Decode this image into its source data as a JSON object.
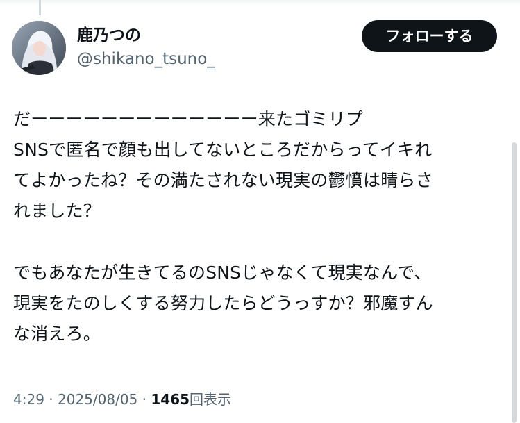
{
  "author": {
    "display_name": "鹿乃つの",
    "handle": "@shikano_tsuno_"
  },
  "follow_label": "フォローする",
  "tweet": {
    "lines": [
      "だーーーーーーーーーーーーー来たゴミリプ",
      "SNSで匿名で顔も出してないところだからってイキれ",
      "てよかったね？その満たされない現実の鬱憤は晴らさ",
      "れました？",
      "",
      "でもあなたが生きてるのSNSじゃなくて現実なんで、",
      "現実をたのしくする努力したらどうっすか？邪魔すん",
      "な消えろ。"
    ]
  },
  "meta": {
    "time": "4:29",
    "separator": "·",
    "date": "2025/08/05",
    "views_count": "1465",
    "views_label": "回表示"
  },
  "icons": {
    "avatar": "profile-photo"
  },
  "colors": {
    "text_primary": "#0f1419",
    "text_secondary": "#536471",
    "follow_button_bg": "#0f1419",
    "follow_button_text": "#ffffff"
  }
}
